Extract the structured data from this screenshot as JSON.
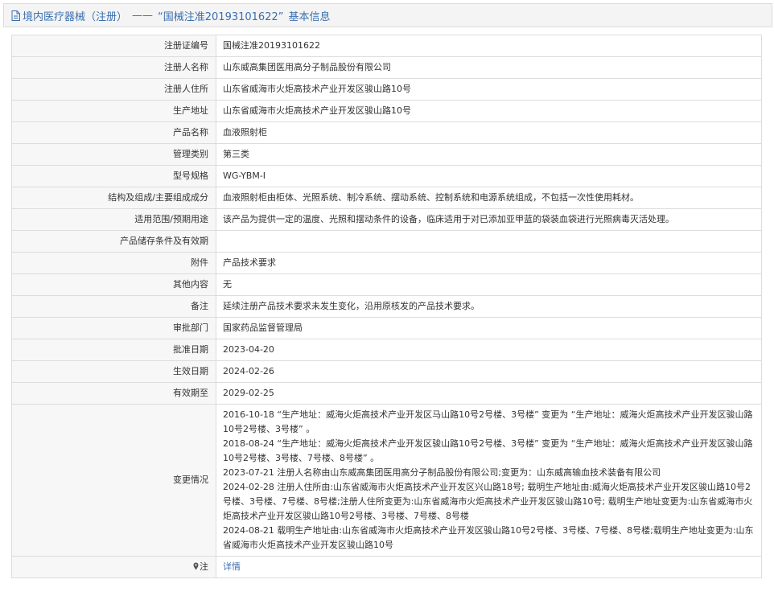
{
  "header": {
    "category": "境内医疗器械（注册）",
    "separator": "——",
    "record_title": "“国械注准20193101622”",
    "suffix": "基本信息"
  },
  "rows": [
    {
      "label": "注册证编号",
      "value": "国械注准20193101622"
    },
    {
      "label": "注册人名称",
      "value": "山东威高集团医用高分子制品股份有限公司"
    },
    {
      "label": "注册人住所",
      "value": "山东省威海市火炬高技术产业开发区骏山路10号"
    },
    {
      "label": "生产地址",
      "value": "山东省威海市火炬高技术产业开发区骏山路10号"
    },
    {
      "label": "产品名称",
      "value": "血液照射柜"
    },
    {
      "label": "管理类别",
      "value": "第三类"
    },
    {
      "label": "型号规格",
      "value": "WG-YBM-Ⅰ"
    },
    {
      "label": "结构及组成/主要组成成分",
      "value": "血液照射柜由柜体、光照系统、制冷系统、摆动系统、控制系统和电源系统组成，不包括一次性使用耗材。"
    },
    {
      "label": "适用范围/预期用途",
      "value": "该产品为提供一定的温度、光照和摆动条件的设备，临床适用于对已添加亚甲蓝的袋装血袋进行光照病毒灭活处理。"
    },
    {
      "label": "产品储存条件及有效期",
      "value": ""
    },
    {
      "label": "附件",
      "value": "产品技术要求"
    },
    {
      "label": "其他内容",
      "value": "无"
    },
    {
      "label": "备注",
      "value": "延续注册产品技术要求未发生变化，沿用原核发的产品技术要求。"
    },
    {
      "label": "审批部门",
      "value": "国家药品监督管理局"
    },
    {
      "label": "批准日期",
      "value": "2023-04-20"
    },
    {
      "label": "生效日期",
      "value": "2024-02-26"
    },
    {
      "label": "有效期至",
      "value": "2029-02-25"
    }
  ],
  "changes": {
    "label": "变更情况",
    "entries": [
      "2016-10-18 “生产地址：威海火炬高技术产业开发区马山路10号2号楼、3号楼” 变更为 “生产地址：威海火炬高技术产业开发区骏山路10号2号楼、3号楼” 。",
      "2018-08-24 “生产地址：威海火炬高技术产业开发区骏山路10号2号楼、3号楼” 变更为 “生产地址：威海火炬高技术产业开发区骏山路10号2号楼、3号楼、7号楼、8号楼” 。",
      "2023-07-21 注册人名称由山东威高集团医用高分子制品股份有限公司;变更为：山东威高输血技术装备有限公司",
      "2024-02-28 注册人住所由:山东省威海市火炬高技术产业开发区兴山路18号; 载明生产地址由:威海火炬高技术产业开发区骏山路10号2号楼、3号楼、7号楼、8号楼;注册人住所变更为:山东省威海市火炬高技术产业开发区骏山路10号; 载明生产地址变更为:山东省威海市火炬高技术产业开发区骏山路10号2号楼、3号楼、7号楼、8号楼",
      "2024-08-21 载明生产地址由:山东省威海市火炬高技术产业开发区骏山路10号2号楼、3号楼、7号楼、8号楼;载明生产地址变更为:山东省威海市火炬高技术产业开发区骏山路10号"
    ]
  },
  "note": {
    "label": "注",
    "link_text": "详情",
    "icon": "map-pin-icon"
  },
  "colors": {
    "accent": "#3a6fb0",
    "label_bg": "#f7f7f7",
    "border": "#dcdcdc"
  }
}
